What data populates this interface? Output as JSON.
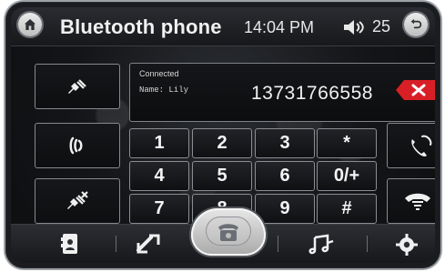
{
  "header": {
    "title": "Bluetooth phone",
    "time": "14:04 PM",
    "volume": "25"
  },
  "connection": {
    "status": "Connected",
    "name": "Name: Lily"
  },
  "dial": {
    "number": "13731766558"
  },
  "keypad": {
    "keys": [
      "1",
      "2",
      "3",
      "*",
      "4",
      "5",
      "6",
      "0/+",
      "7",
      "8",
      "9",
      "#"
    ]
  },
  "colors": {
    "backspace": "#d81f26",
    "accent_gray": "#86898f"
  },
  "icons": {
    "home": "home-icon",
    "back": "back-icon",
    "volume": "volume-icon",
    "plug": "plug-icon",
    "phone_book": "phonebook-icon",
    "transfer": "transfer-icon",
    "call": "call-icon",
    "music": "music-icon",
    "settings": "gear-icon",
    "hangup": "hangup-icon",
    "backspace": "backspace-icon",
    "handset": "handset-icon"
  }
}
